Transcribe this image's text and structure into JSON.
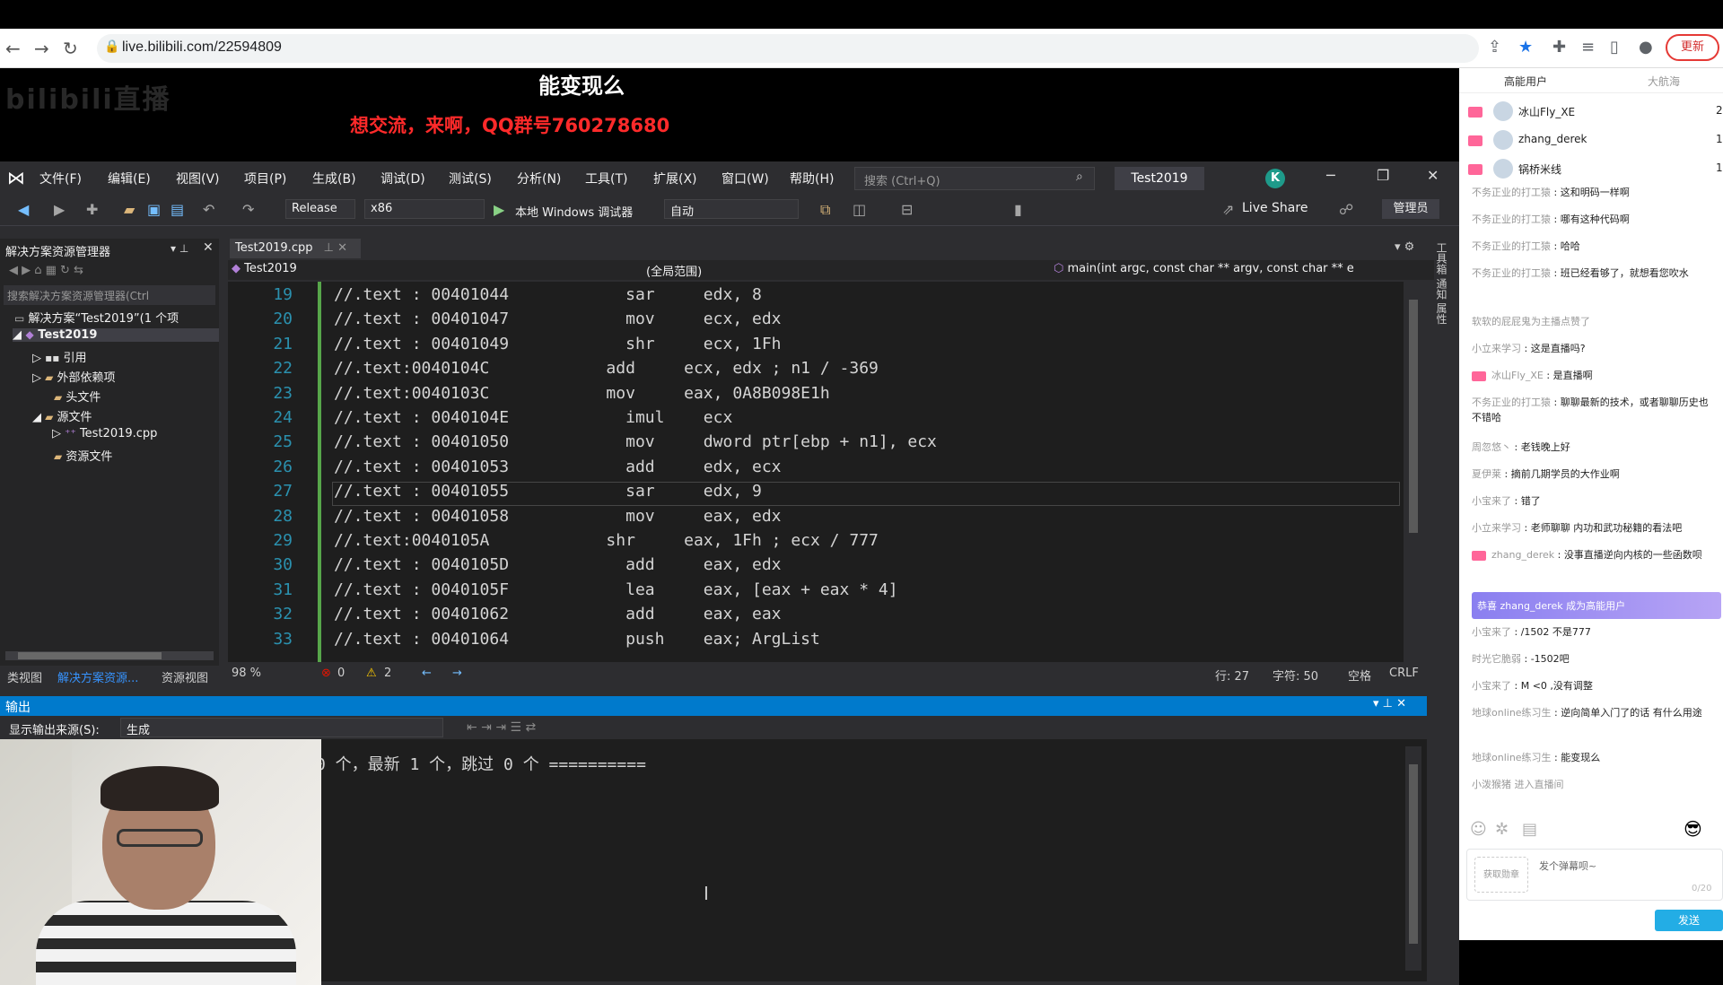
{
  "browser": {
    "url": "live.bilibili.com/22594809",
    "update_label": "更新"
  },
  "stream": {
    "title": "能变现么",
    "logo_text": "bilibili直播",
    "banner": "想交流，来啊，QQ群号760278680"
  },
  "vs": {
    "menu": [
      "文件(F)",
      "编辑(E)",
      "视图(V)",
      "项目(P)",
      "生成(B)",
      "调试(D)",
      "测试(S)",
      "分析(N)",
      "工具(T)",
      "扩展(X)",
      "窗口(W)",
      "帮助(H)"
    ],
    "search_placeholder": "搜索 (Ctrl+Q)",
    "project_name": "Test2019",
    "avatar_letter": "K",
    "config": "Release",
    "platform": "x86",
    "run_label": "本地 Windows 调试器",
    "run_mode": "自动",
    "live_share": "Live Share",
    "admin": "管理员"
  },
  "solution_explorer": {
    "title": "解决方案资源管理器",
    "search_placeholder": "搜索解决方案资源管理器(Ctrl",
    "items": [
      {
        "label": "解决方案“Test2019”(1 个项"
      },
      {
        "label": "Test2019"
      },
      {
        "label": "引用"
      },
      {
        "label": "外部依赖项"
      },
      {
        "label": "头文件"
      },
      {
        "label": "源文件"
      },
      {
        "label": "Test2019.cpp"
      },
      {
        "label": "资源文件"
      }
    ],
    "tabs": [
      "类视图",
      "解决方案资源...",
      "资源视图"
    ]
  },
  "editor": {
    "tab": "Test2019.cpp",
    "nav_project": "Test2019",
    "nav_scope": "(全局范围)",
    "nav_func": "main(int argc, const char ** argv, const char ** e",
    "lines": [
      {
        "n": "19",
        "code": "//.text : 00401044            sar     edx, 8"
      },
      {
        "n": "20",
        "code": "//.text : 00401047            mov     ecx, edx"
      },
      {
        "n": "21",
        "code": "//.text : 00401049            shr     ecx, 1Fh"
      },
      {
        "n": "22",
        "code": "//.text:0040104C            add     ecx, edx ; n1 / -369"
      },
      {
        "n": "23",
        "code": "//.text:0040103C            mov     eax, 0A8B098E1h"
      },
      {
        "n": "24",
        "code": "//.text : 0040104E            imul    ecx"
      },
      {
        "n": "25",
        "code": "//.text : 00401050            mov     dword ptr[ebp + n1], ecx"
      },
      {
        "n": "26",
        "code": "//.text : 00401053            add     edx, ecx"
      },
      {
        "n": "27",
        "code": "//.text : 00401055            sar     edx, 9"
      },
      {
        "n": "28",
        "code": "//.text : 00401058            mov     eax, edx"
      },
      {
        "n": "29",
        "code": "//.text:0040105A            shr     eax, 1Fh ; ecx / 777"
      },
      {
        "n": "30",
        "code": "//.text : 0040105D            add     eax, edx"
      },
      {
        "n": "31",
        "code": "//.text : 0040105F            lea     eax, [eax + eax * 4]"
      },
      {
        "n": "32",
        "code": "//.text : 00401062            add     eax, eax"
      },
      {
        "n": "33",
        "code": "//.text : 00401064            push    eax; ArgList"
      }
    ],
    "zoom": "98 %",
    "errors": "0",
    "warnings": "2",
    "row": "行: 27",
    "col": "字符: 50",
    "whitespace": "空格",
    "eol": "CRLF"
  },
  "output": {
    "title": "输出",
    "source_label": "显示输出来源(S):",
    "source_value": "生成",
    "text": "0 个，最新 1 个，跳过 0 个 =========="
  },
  "chat": {
    "tabs": [
      "高能用户",
      "大航海"
    ],
    "top_users": [
      {
        "name": "冰山Fly_XE",
        "count": "2"
      },
      {
        "name": "zhang_derek",
        "count": "1"
      },
      {
        "name": "锅桥米线",
        "count": "1"
      }
    ],
    "messages": [
      {
        "user": "不务正业的打工猿",
        "text": "这和明码一样啊"
      },
      {
        "user": "不务正业的打工猿",
        "text": "哪有这种代码啊"
      },
      {
        "user": "不务正业的打工猿",
        "text": "哈哈"
      },
      {
        "user": "不务正业的打工猿",
        "text": "班已经看够了，就想看您吹水"
      },
      {
        "user": "软软的屁屁鬼为主播点赞了",
        "text": ""
      },
      {
        "user": "小立来学习",
        "text": "这是直播吗?"
      },
      {
        "user": "冰山Fly_XE",
        "text": "是直播啊"
      },
      {
        "user": "不务正业的打工猿",
        "text": "聊聊最新的技术，或者聊聊历史也不错哈"
      },
      {
        "user": "周忽悠丶",
        "text": "老钱晚上好"
      },
      {
        "user": "夏伊莱",
        "text": "摘前几期学员的大作业啊"
      },
      {
        "user": "小宝来了",
        "text": "错了"
      },
      {
        "user": "小立来学习",
        "text": "老师聊聊 内功和武功秘籍的看法吧"
      },
      {
        "user": "zhang_derek",
        "text": "没事直播逆向内核的一些函数呗"
      },
      {
        "user": "小宝来了",
        "text": "/1502 不是777"
      },
      {
        "user": "时光它脆弱",
        "text": "-1502吧"
      },
      {
        "user": "小宝来了",
        "text": "M <0 ,没有调整"
      },
      {
        "user": "地球online练习生",
        "text": "逆向简单入门了的话 有什么用途"
      },
      {
        "user": "地球online练习生",
        "text": "能变现么"
      },
      {
        "user": "小泼猴猪 进入直播间",
        "text": ""
      }
    ],
    "congrats": "恭喜 zhang_derek 成为高能用户",
    "medal_btn": "获取勋章",
    "input_placeholder": "发个弹幕呗~",
    "char_count": "0/20",
    "send": "发送"
  }
}
